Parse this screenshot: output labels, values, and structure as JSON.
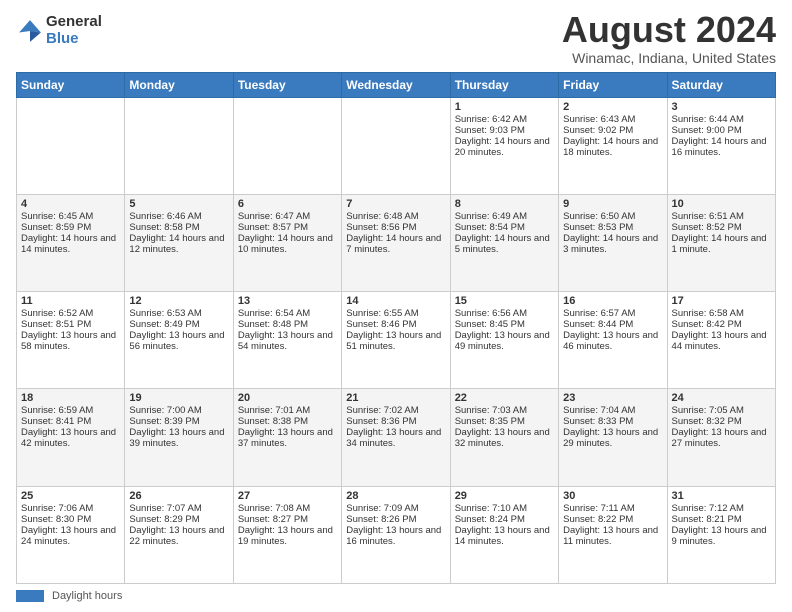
{
  "logo": {
    "general": "General",
    "blue": "Blue"
  },
  "title": "August 2024",
  "subtitle": "Winamac, Indiana, United States",
  "headers": [
    "Sunday",
    "Monday",
    "Tuesday",
    "Wednesday",
    "Thursday",
    "Friday",
    "Saturday"
  ],
  "legend": {
    "label": "Daylight hours"
  },
  "weeks": [
    [
      {
        "day": "",
        "info": ""
      },
      {
        "day": "",
        "info": ""
      },
      {
        "day": "",
        "info": ""
      },
      {
        "day": "",
        "info": ""
      },
      {
        "day": "1",
        "info": "Sunrise: 6:42 AM\nSunset: 9:03 PM\nDaylight: 14 hours and 20 minutes."
      },
      {
        "day": "2",
        "info": "Sunrise: 6:43 AM\nSunset: 9:02 PM\nDaylight: 14 hours and 18 minutes."
      },
      {
        "day": "3",
        "info": "Sunrise: 6:44 AM\nSunset: 9:00 PM\nDaylight: 14 hours and 16 minutes."
      }
    ],
    [
      {
        "day": "4",
        "info": "Sunrise: 6:45 AM\nSunset: 8:59 PM\nDaylight: 14 hours and 14 minutes."
      },
      {
        "day": "5",
        "info": "Sunrise: 6:46 AM\nSunset: 8:58 PM\nDaylight: 14 hours and 12 minutes."
      },
      {
        "day": "6",
        "info": "Sunrise: 6:47 AM\nSunset: 8:57 PM\nDaylight: 14 hours and 10 minutes."
      },
      {
        "day": "7",
        "info": "Sunrise: 6:48 AM\nSunset: 8:56 PM\nDaylight: 14 hours and 7 minutes."
      },
      {
        "day": "8",
        "info": "Sunrise: 6:49 AM\nSunset: 8:54 PM\nDaylight: 14 hours and 5 minutes."
      },
      {
        "day": "9",
        "info": "Sunrise: 6:50 AM\nSunset: 8:53 PM\nDaylight: 14 hours and 3 minutes."
      },
      {
        "day": "10",
        "info": "Sunrise: 6:51 AM\nSunset: 8:52 PM\nDaylight: 14 hours and 1 minute."
      }
    ],
    [
      {
        "day": "11",
        "info": "Sunrise: 6:52 AM\nSunset: 8:51 PM\nDaylight: 13 hours and 58 minutes."
      },
      {
        "day": "12",
        "info": "Sunrise: 6:53 AM\nSunset: 8:49 PM\nDaylight: 13 hours and 56 minutes."
      },
      {
        "day": "13",
        "info": "Sunrise: 6:54 AM\nSunset: 8:48 PM\nDaylight: 13 hours and 54 minutes."
      },
      {
        "day": "14",
        "info": "Sunrise: 6:55 AM\nSunset: 8:46 PM\nDaylight: 13 hours and 51 minutes."
      },
      {
        "day": "15",
        "info": "Sunrise: 6:56 AM\nSunset: 8:45 PM\nDaylight: 13 hours and 49 minutes."
      },
      {
        "day": "16",
        "info": "Sunrise: 6:57 AM\nSunset: 8:44 PM\nDaylight: 13 hours and 46 minutes."
      },
      {
        "day": "17",
        "info": "Sunrise: 6:58 AM\nSunset: 8:42 PM\nDaylight: 13 hours and 44 minutes."
      }
    ],
    [
      {
        "day": "18",
        "info": "Sunrise: 6:59 AM\nSunset: 8:41 PM\nDaylight: 13 hours and 42 minutes."
      },
      {
        "day": "19",
        "info": "Sunrise: 7:00 AM\nSunset: 8:39 PM\nDaylight: 13 hours and 39 minutes."
      },
      {
        "day": "20",
        "info": "Sunrise: 7:01 AM\nSunset: 8:38 PM\nDaylight: 13 hours and 37 minutes."
      },
      {
        "day": "21",
        "info": "Sunrise: 7:02 AM\nSunset: 8:36 PM\nDaylight: 13 hours and 34 minutes."
      },
      {
        "day": "22",
        "info": "Sunrise: 7:03 AM\nSunset: 8:35 PM\nDaylight: 13 hours and 32 minutes."
      },
      {
        "day": "23",
        "info": "Sunrise: 7:04 AM\nSunset: 8:33 PM\nDaylight: 13 hours and 29 minutes."
      },
      {
        "day": "24",
        "info": "Sunrise: 7:05 AM\nSunset: 8:32 PM\nDaylight: 13 hours and 27 minutes."
      }
    ],
    [
      {
        "day": "25",
        "info": "Sunrise: 7:06 AM\nSunset: 8:30 PM\nDaylight: 13 hours and 24 minutes."
      },
      {
        "day": "26",
        "info": "Sunrise: 7:07 AM\nSunset: 8:29 PM\nDaylight: 13 hours and 22 minutes."
      },
      {
        "day": "27",
        "info": "Sunrise: 7:08 AM\nSunset: 8:27 PM\nDaylight: 13 hours and 19 minutes."
      },
      {
        "day": "28",
        "info": "Sunrise: 7:09 AM\nSunset: 8:26 PM\nDaylight: 13 hours and 16 minutes."
      },
      {
        "day": "29",
        "info": "Sunrise: 7:10 AM\nSunset: 8:24 PM\nDaylight: 13 hours and 14 minutes."
      },
      {
        "day": "30",
        "info": "Sunrise: 7:11 AM\nSunset: 8:22 PM\nDaylight: 13 hours and 11 minutes."
      },
      {
        "day": "31",
        "info": "Sunrise: 7:12 AM\nSunset: 8:21 PM\nDaylight: 13 hours and 9 minutes."
      }
    ]
  ]
}
